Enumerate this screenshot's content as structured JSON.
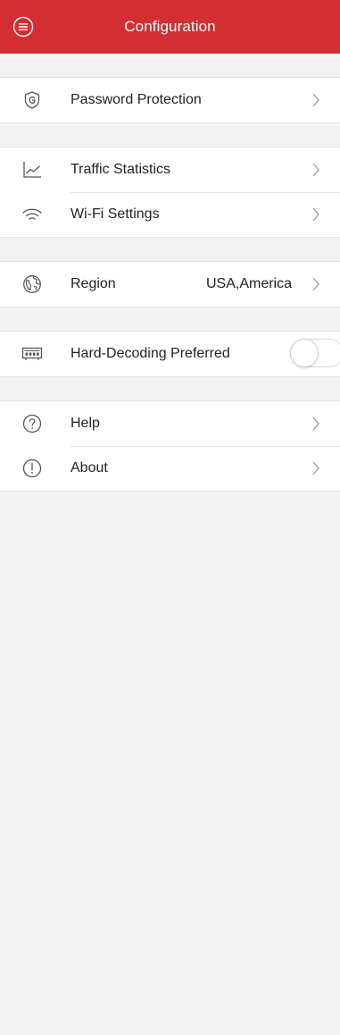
{
  "header": {
    "title": "Configuration",
    "menu_icon": "menu-circle-icon",
    "background": "#d32e32"
  },
  "groups": [
    {
      "items": [
        {
          "label": "Password Protection",
          "icon": "shield-icon"
        }
      ]
    },
    {
      "items": [
        {
          "label": "Traffic Statistics",
          "icon": "line-chart-icon"
        },
        {
          "label": "Wi-Fi Settings",
          "icon": "wifi-icon"
        }
      ]
    },
    {
      "items": [
        {
          "label": "Region",
          "value": "USA,America",
          "icon": "globe-icon"
        }
      ]
    },
    {
      "items": [
        {
          "label": "Hard-Decoding Preferred",
          "icon": "chip-icon",
          "toggle_on": false
        }
      ]
    },
    {
      "items": [
        {
          "label": "Help",
          "icon": "question-icon"
        },
        {
          "label": "About",
          "icon": "exclamation-icon"
        }
      ]
    }
  ],
  "colors": {
    "accent": "#d32e32",
    "icon": "#555555",
    "chevron": "#9a9a9a",
    "background": "#f2f2f2"
  }
}
